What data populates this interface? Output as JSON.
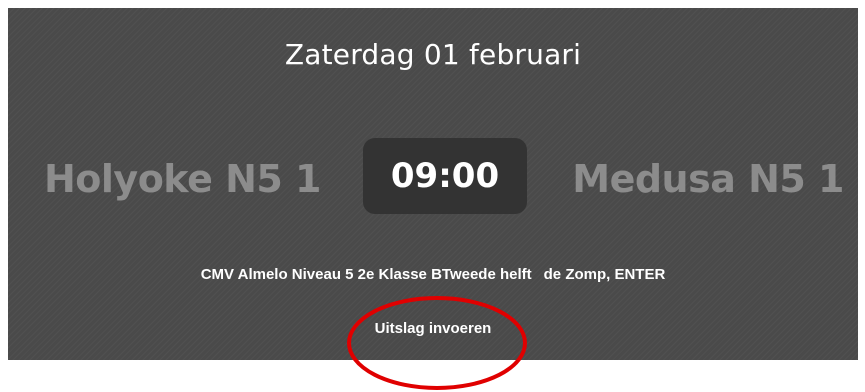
{
  "match": {
    "date": "Zaterdag 01 februari",
    "home_team": "Holyoke N5 1",
    "away_team": "Medusa N5 1",
    "time": "09:00",
    "competition": "CMV Almelo Niveau 5 2e Klasse BTweede helft",
    "venue": "de Zomp, ENTER",
    "result_link": "Uitslag invoeren"
  },
  "colors": {
    "card_background": "#4a4a4a",
    "team_name": "#8c8c8c",
    "time_box": "#333333",
    "annotation": "#e00000"
  }
}
